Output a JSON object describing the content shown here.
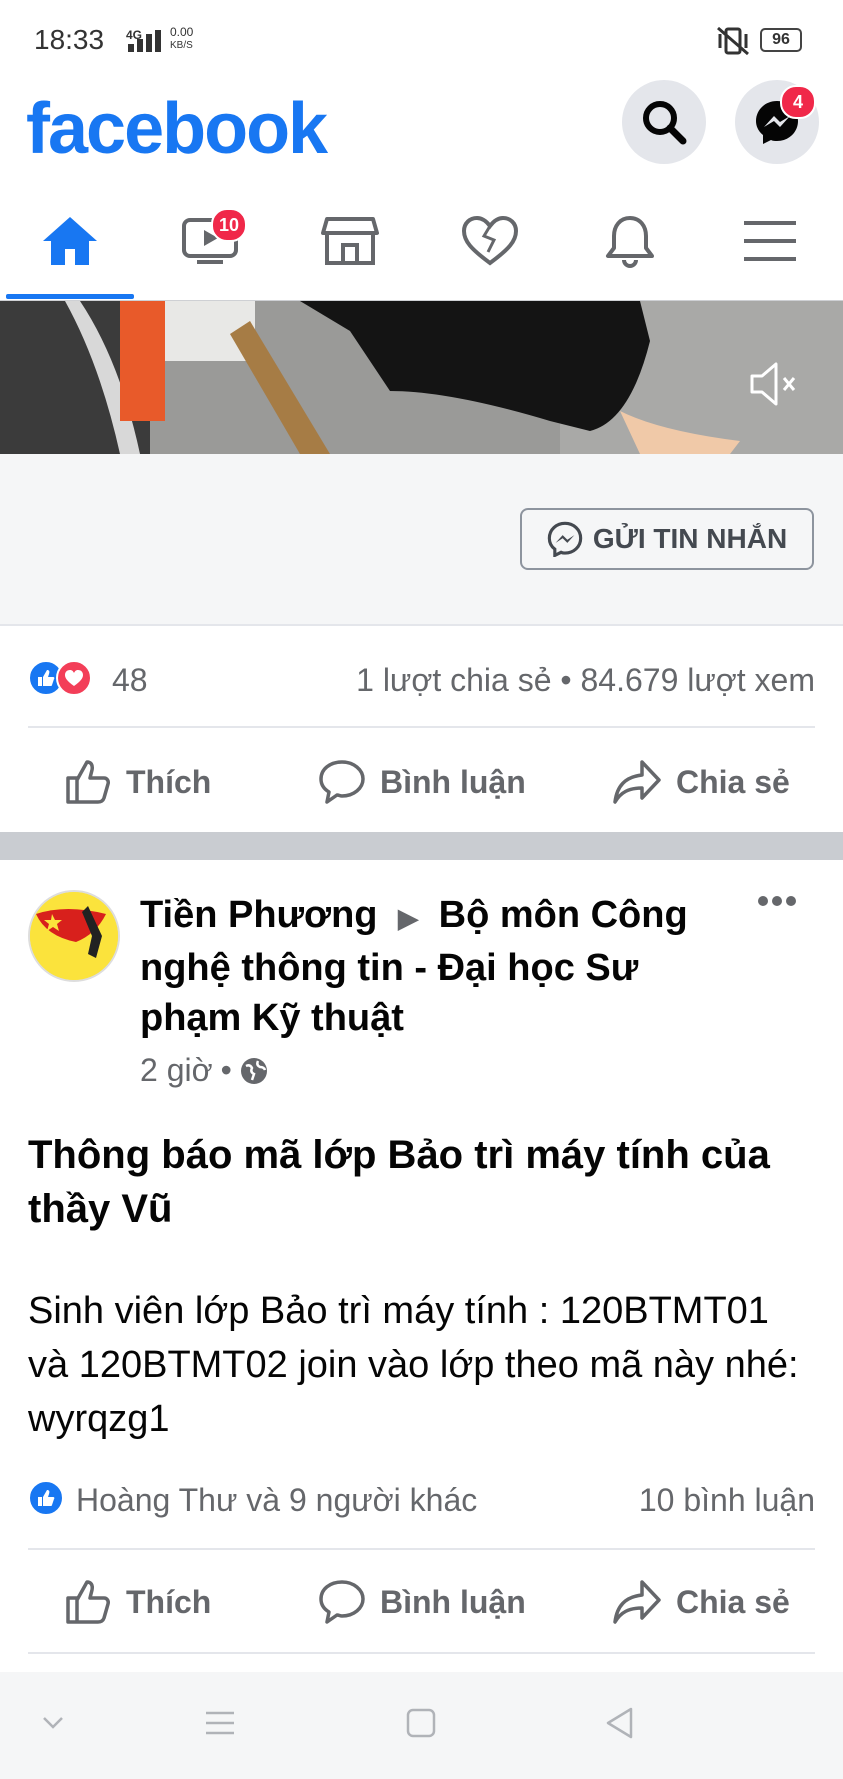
{
  "status_bar": {
    "time": "18:33",
    "network": "4G",
    "speed_value": "0.00",
    "speed_unit": "KB/S",
    "battery": "96"
  },
  "header": {
    "logo": "facebook",
    "messenger_badge": "4"
  },
  "nav": {
    "watch_badge": "10",
    "active_tab": "home"
  },
  "post1": {
    "send_message_label": "GỬI TIN NHẮN",
    "reaction_count": "48",
    "share_views": "1 lượt chia sẻ • 84.679 lượt xem"
  },
  "actions": {
    "like": "Thích",
    "comment": "Bình luận",
    "share": "Chia sẻ"
  },
  "post2": {
    "author": "Tiền Phương",
    "group": "Bộ môn Công nghệ thông tin - Đại học Sư phạm Kỹ thuật",
    "time": "2 giờ",
    "dot": "•",
    "title": "Thông báo mã lớp Bảo trì máy tính của thầy Vũ",
    "body": "Sinh viên lớp Bảo trì máy tính : 120BTMT01 và 120BTMT02 join vào lớp theo mã này nhé: wyrqzg1",
    "reactors": "Hoàng Thư và 9 người khác",
    "comments": "10 bình luận"
  },
  "colors": {
    "brand": "#1877f2",
    "badge": "#f02849",
    "secondary_text": "#65676b"
  }
}
